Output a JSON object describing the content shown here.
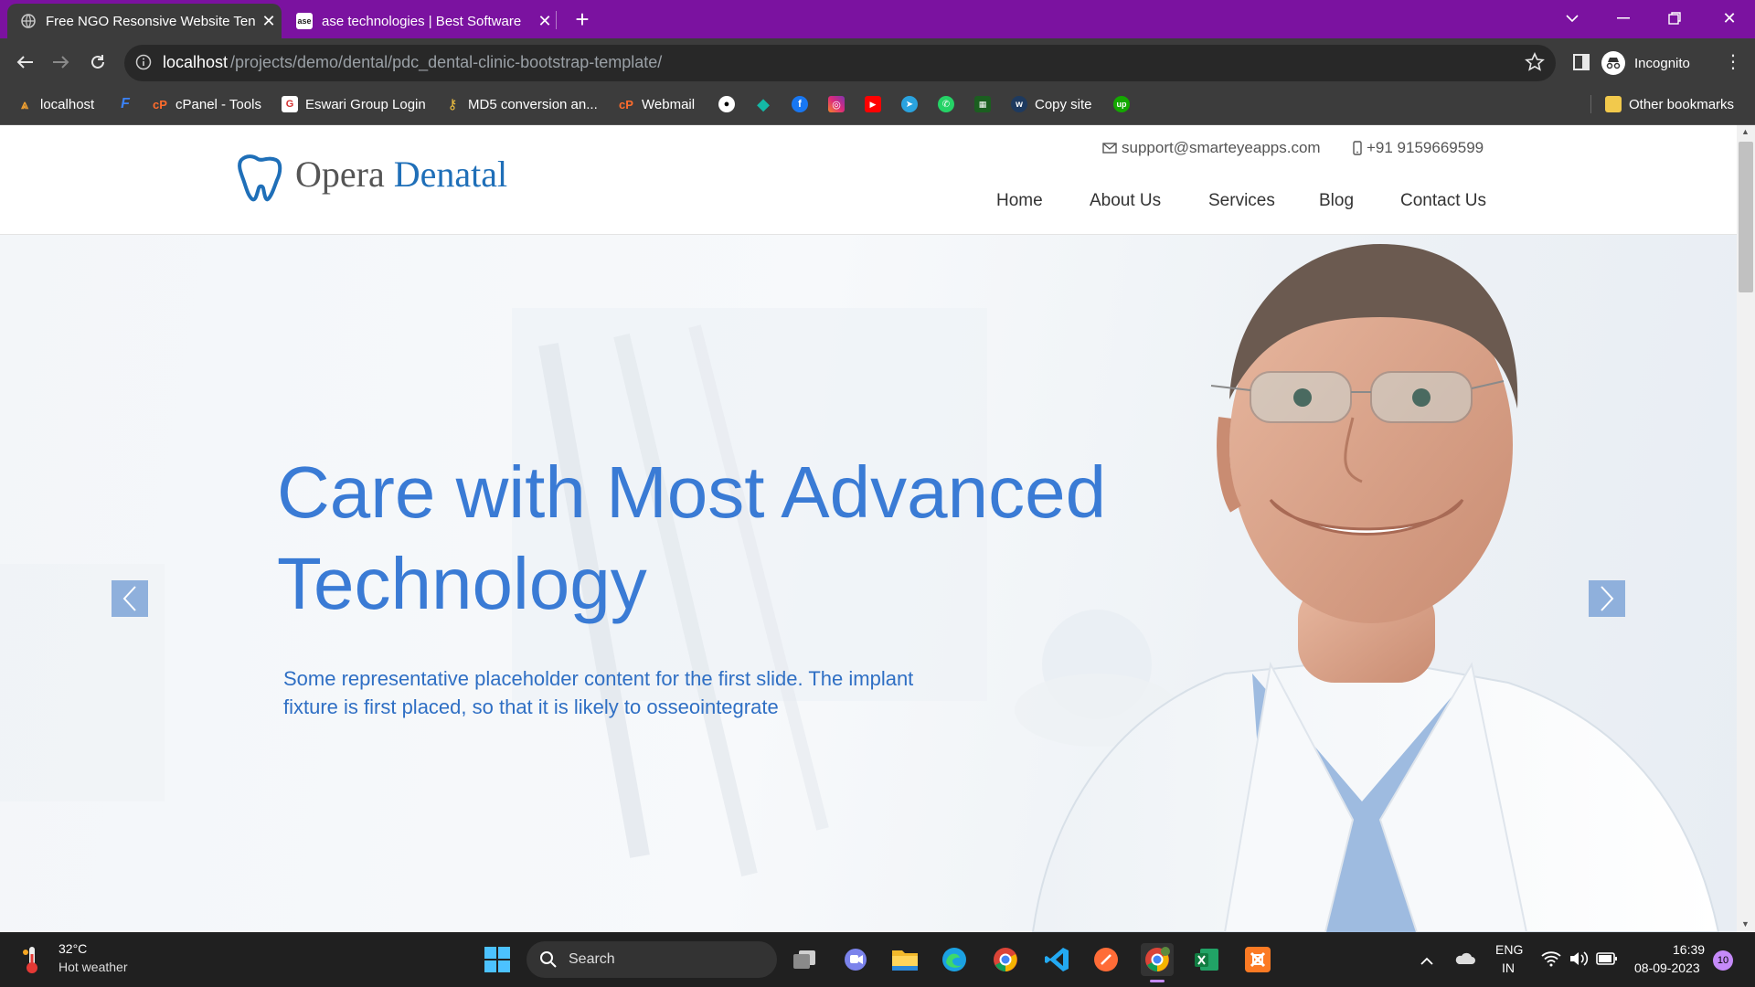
{
  "browser": {
    "tabs": [
      {
        "title": "Free NGO Resonsive Website Ten",
        "active": true
      },
      {
        "title": "ase technologies | Best Software",
        "active": false
      }
    ],
    "url_host": "localhost",
    "url_path": "/projects/demo/dental/pdc_dental-clinic-bootstrap-template/",
    "profile_label": "Incognito",
    "bookmarks": [
      {
        "label": "localhost",
        "icon": "localhost-icon"
      },
      {
        "label": "",
        "icon": "f-icon"
      },
      {
        "label": "cPanel - Tools",
        "icon": "cpanel-icon"
      },
      {
        "label": "Eswari Group Login",
        "icon": "eswari-icon"
      },
      {
        "label": "MD5 conversion an...",
        "icon": "key-icon"
      },
      {
        "label": "Webmail",
        "icon": "cpanel-icon"
      },
      {
        "label": "",
        "icon": "github-icon"
      },
      {
        "label": "",
        "icon": "diamond-icon"
      },
      {
        "label": "",
        "icon": "facebook-icon"
      },
      {
        "label": "",
        "icon": "instagram-icon"
      },
      {
        "label": "",
        "icon": "youtube-icon"
      },
      {
        "label": "",
        "icon": "telegram-icon"
      },
      {
        "label": "",
        "icon": "whatsapp-icon"
      },
      {
        "label": "",
        "icon": "excel-sheet-icon"
      },
      {
        "label": "Copy site",
        "icon": "w-icon"
      },
      {
        "label": "",
        "icon": "upwork-icon"
      }
    ],
    "other_bookmarks": "Other bookmarks"
  },
  "site": {
    "logo_text_1": "Opera",
    "logo_text_2": "Denatal",
    "email": "support@smarteyeapps.com",
    "phone": "+91 9159669599",
    "nav": [
      "Home",
      "About Us",
      "Services",
      "Blog",
      "Contact Us"
    ],
    "hero": {
      "title": "Care with Most Advanced Technology",
      "description": "Some representative placeholder content for the first slide. The implant fixture is first placed, so that it is likely to osseointegrate"
    }
  },
  "taskbar": {
    "weather_temp": "32°C",
    "weather_desc": "Hot weather",
    "search_label": "Search",
    "lang_1": "ENG",
    "lang_2": "IN",
    "time": "16:39",
    "date": "08-09-2023",
    "notification_count": "10"
  },
  "colors": {
    "tabbar": "#7b12a0",
    "hero_title": "#3a7bd5",
    "logo_accent": "#1f6fb8"
  }
}
